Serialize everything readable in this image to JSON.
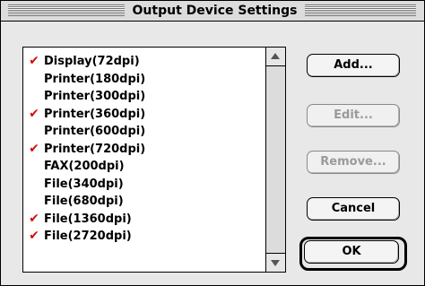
{
  "window": {
    "title": "Output Device Settings"
  },
  "devices": [
    {
      "label": "Display(72dpi)",
      "checked": true
    },
    {
      "label": "Printer(180dpi)",
      "checked": false
    },
    {
      "label": "Printer(300dpi)",
      "checked": false
    },
    {
      "label": "Printer(360dpi)",
      "checked": true
    },
    {
      "label": "Printer(600dpi)",
      "checked": false
    },
    {
      "label": "Printer(720dpi)",
      "checked": true
    },
    {
      "label": "FAX(200dpi)",
      "checked": false
    },
    {
      "label": "File(340dpi)",
      "checked": false
    },
    {
      "label": "File(680dpi)",
      "checked": false
    },
    {
      "label": "File(1360dpi)",
      "checked": true
    },
    {
      "label": "File(2720dpi)",
      "checked": true
    }
  ],
  "check_glyph": "✔",
  "buttons": {
    "add": "Add...",
    "edit": "Edit...",
    "remove": "Remove...",
    "cancel": "Cancel",
    "ok": "OK"
  },
  "colors": {
    "check": "#d01010",
    "disabled_text": "#9a9a9a"
  },
  "icons": {
    "scroll_up": "triangle-up-icon",
    "scroll_down": "triangle-down-icon"
  }
}
